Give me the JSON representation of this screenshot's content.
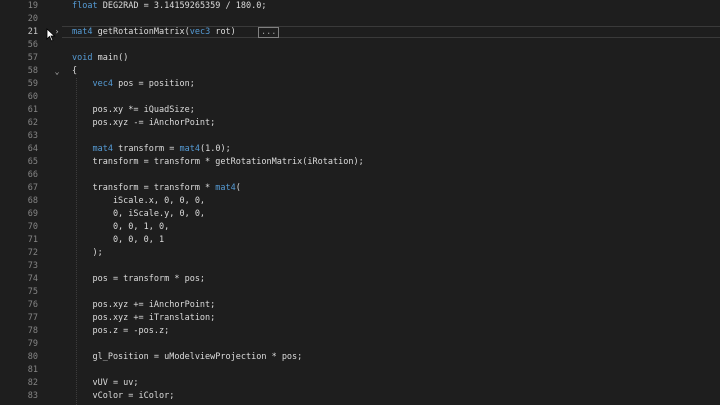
{
  "editor": {
    "collapsed_marker": "...",
    "fold_expanded": "⌄",
    "fold_collapsed": "›",
    "lines": [
      {
        "n": "19",
        "text": "float DEG2RAD = 3.14159265359 / 180.0;"
      },
      {
        "n": "20",
        "text": ""
      },
      {
        "n": "21",
        "text": "mat4 getRotationMatrix(vec3 rot)"
      },
      {
        "n": "56",
        "text": ""
      },
      {
        "n": "57",
        "text": "void main()"
      },
      {
        "n": "58",
        "text": "{"
      },
      {
        "n": "59",
        "text": "    vec4 pos = position;"
      },
      {
        "n": "60",
        "text": ""
      },
      {
        "n": "61",
        "text": "    pos.xy *= iQuadSize;"
      },
      {
        "n": "62",
        "text": "    pos.xyz -= iAnchorPoint;"
      },
      {
        "n": "63",
        "text": ""
      },
      {
        "n": "64",
        "text": "    mat4 transform = mat4(1.0);"
      },
      {
        "n": "65",
        "text": "    transform = transform * getRotationMatrix(iRotation);"
      },
      {
        "n": "66",
        "text": ""
      },
      {
        "n": "67",
        "text": "    transform = transform * mat4("
      },
      {
        "n": "68",
        "text": "        iScale.x, 0, 0, 0,"
      },
      {
        "n": "69",
        "text": "        0, iScale.y, 0, 0,"
      },
      {
        "n": "70",
        "text": "        0, 0, 1, 0,"
      },
      {
        "n": "71",
        "text": "        0, 0, 0, 1"
      },
      {
        "n": "72",
        "text": "    );"
      },
      {
        "n": "73",
        "text": ""
      },
      {
        "n": "74",
        "text": "    pos = transform * pos;"
      },
      {
        "n": "75",
        "text": ""
      },
      {
        "n": "76",
        "text": "    pos.xyz += iAnchorPoint;"
      },
      {
        "n": "77",
        "text": "    pos.xyz += iTranslation;"
      },
      {
        "n": "78",
        "text": "    pos.z = -pos.z;"
      },
      {
        "n": "79",
        "text": ""
      },
      {
        "n": "80",
        "text": "    gl_Position = uModelviewProjection * pos;"
      },
      {
        "n": "81",
        "text": ""
      },
      {
        "n": "82",
        "text": "    vUV = uv;"
      },
      {
        "n": "83",
        "text": "    vColor = iColor;"
      }
    ]
  },
  "colors": {
    "background": "#1e1e1e",
    "text": "#dcdcdc",
    "keyword": "#569cd6",
    "line_number": "#858585"
  }
}
